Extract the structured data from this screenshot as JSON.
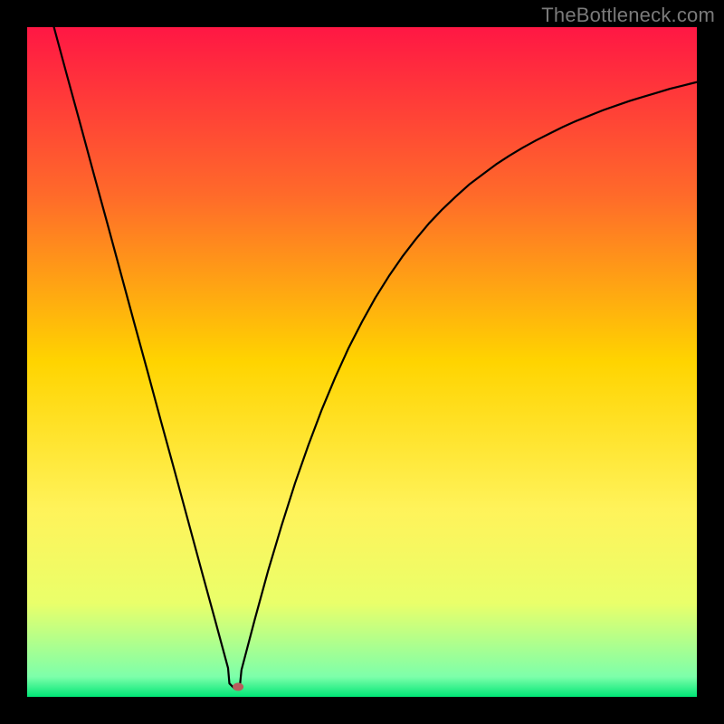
{
  "watermark": "TheBottleneck.com",
  "chart_data": {
    "type": "line",
    "title": "",
    "xlabel": "",
    "ylabel": "",
    "xlim": [
      0,
      100
    ],
    "ylim": [
      0,
      100
    ],
    "grid": false,
    "legend": null,
    "background_gradient": {
      "stops": [
        {
          "pos": 0.0,
          "color": "#ff1744"
        },
        {
          "pos": 0.25,
          "color": "#ff6a2a"
        },
        {
          "pos": 0.5,
          "color": "#ffd400"
        },
        {
          "pos": 0.72,
          "color": "#fff35a"
        },
        {
          "pos": 0.86,
          "color": "#eaff6a"
        },
        {
          "pos": 0.97,
          "color": "#7dffaa"
        },
        {
          "pos": 1.0,
          "color": "#00e676"
        }
      ]
    },
    "marker": {
      "x": 31.5,
      "y": 1.5,
      "color": "#b85c5c"
    },
    "series": [
      {
        "name": "curve",
        "color": "#000000",
        "x": [
          4,
          6,
          8,
          10,
          12,
          14,
          16,
          18,
          20,
          22,
          24,
          26,
          28,
          30,
          30.2,
          31.0,
          31.8,
          32.0,
          34,
          36,
          38,
          40,
          42,
          44,
          46,
          48,
          50,
          52,
          54,
          56,
          58,
          60,
          62,
          64,
          66,
          68,
          70,
          72,
          74,
          76,
          78,
          80,
          82,
          84,
          86,
          88,
          90,
          92,
          94,
          96,
          98,
          100
        ],
        "y": [
          100,
          92.6,
          85.3,
          77.9,
          70.6,
          63.2,
          55.8,
          48.5,
          41.1,
          33.8,
          26.4,
          19.0,
          11.7,
          4.3,
          2.0,
          1.2,
          2.0,
          4.0,
          11.6,
          18.9,
          25.6,
          31.9,
          37.6,
          42.9,
          47.7,
          52.1,
          56.0,
          59.6,
          62.8,
          65.7,
          68.3,
          70.7,
          72.8,
          74.7,
          76.5,
          78.0,
          79.5,
          80.8,
          82.0,
          83.1,
          84.1,
          85.1,
          86.0,
          86.8,
          87.6,
          88.3,
          89.0,
          89.6,
          90.2,
          90.8,
          91.3,
          91.8
        ]
      }
    ]
  }
}
